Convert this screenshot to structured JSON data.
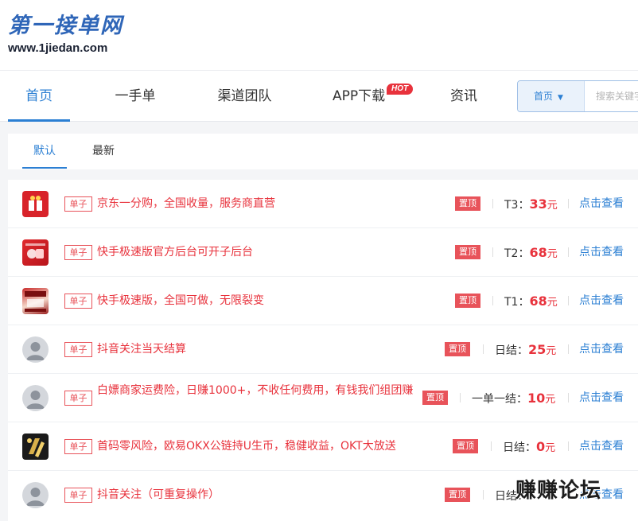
{
  "logo": {
    "cn": "第一接单网",
    "url": "www.1jiedan.com"
  },
  "nav": {
    "items": [
      "首页",
      "一手单",
      "渠道团队",
      "APP下载",
      "资讯"
    ],
    "hot_badge": "HOT"
  },
  "search": {
    "select_value": "首页",
    "placeholder": "搜索关键字"
  },
  "tabs": [
    "默认",
    "最新"
  ],
  "rows": [
    {
      "type": "单子",
      "title": "京东一分购，全国收量，服务商直营",
      "tag": "置顶",
      "price_label": "T3：",
      "price": "33",
      "unit": "元",
      "action": "点击查看"
    },
    {
      "type": "单子",
      "title": "快手极速版官方后台可开子后台",
      "tag": "置顶",
      "price_label": "T2：",
      "price": "68",
      "unit": "元",
      "action": "点击查看"
    },
    {
      "type": "单子",
      "title": "快手极速版，全国可做，无限裂变",
      "tag": "置顶",
      "price_label": "T1：",
      "price": "68",
      "unit": "元",
      "action": "点击查看"
    },
    {
      "type": "单子",
      "title": "抖音关注当天结算",
      "tag": "置顶",
      "price_label": "日结：",
      "price": "25",
      "unit": "元",
      "action": "点击查看"
    },
    {
      "type": "单子",
      "title": "白嫖商家运费险，日赚1000+，不收任何费用，有钱我们组团赚",
      "tag": "置顶",
      "price_label": "一单一结：",
      "price": "10",
      "unit": "元",
      "action": "点击查看"
    },
    {
      "type": "单子",
      "title": "首码零风险，欧易OKX公链持U生币，稳健收益，OKT大放送",
      "tag": "置顶",
      "price_label": "日结：",
      "price": "0",
      "unit": "元",
      "action": "点击查看"
    },
    {
      "type": "单子",
      "title": "抖音关注（可重复操作）",
      "tag": "置顶",
      "price_label": "日结：",
      "price": "",
      "unit": "",
      "action": "点击查看"
    }
  ],
  "watermark": "赚赚论坛",
  "colors": {
    "accent": "#2b7fd3",
    "red": "#e8323c"
  }
}
